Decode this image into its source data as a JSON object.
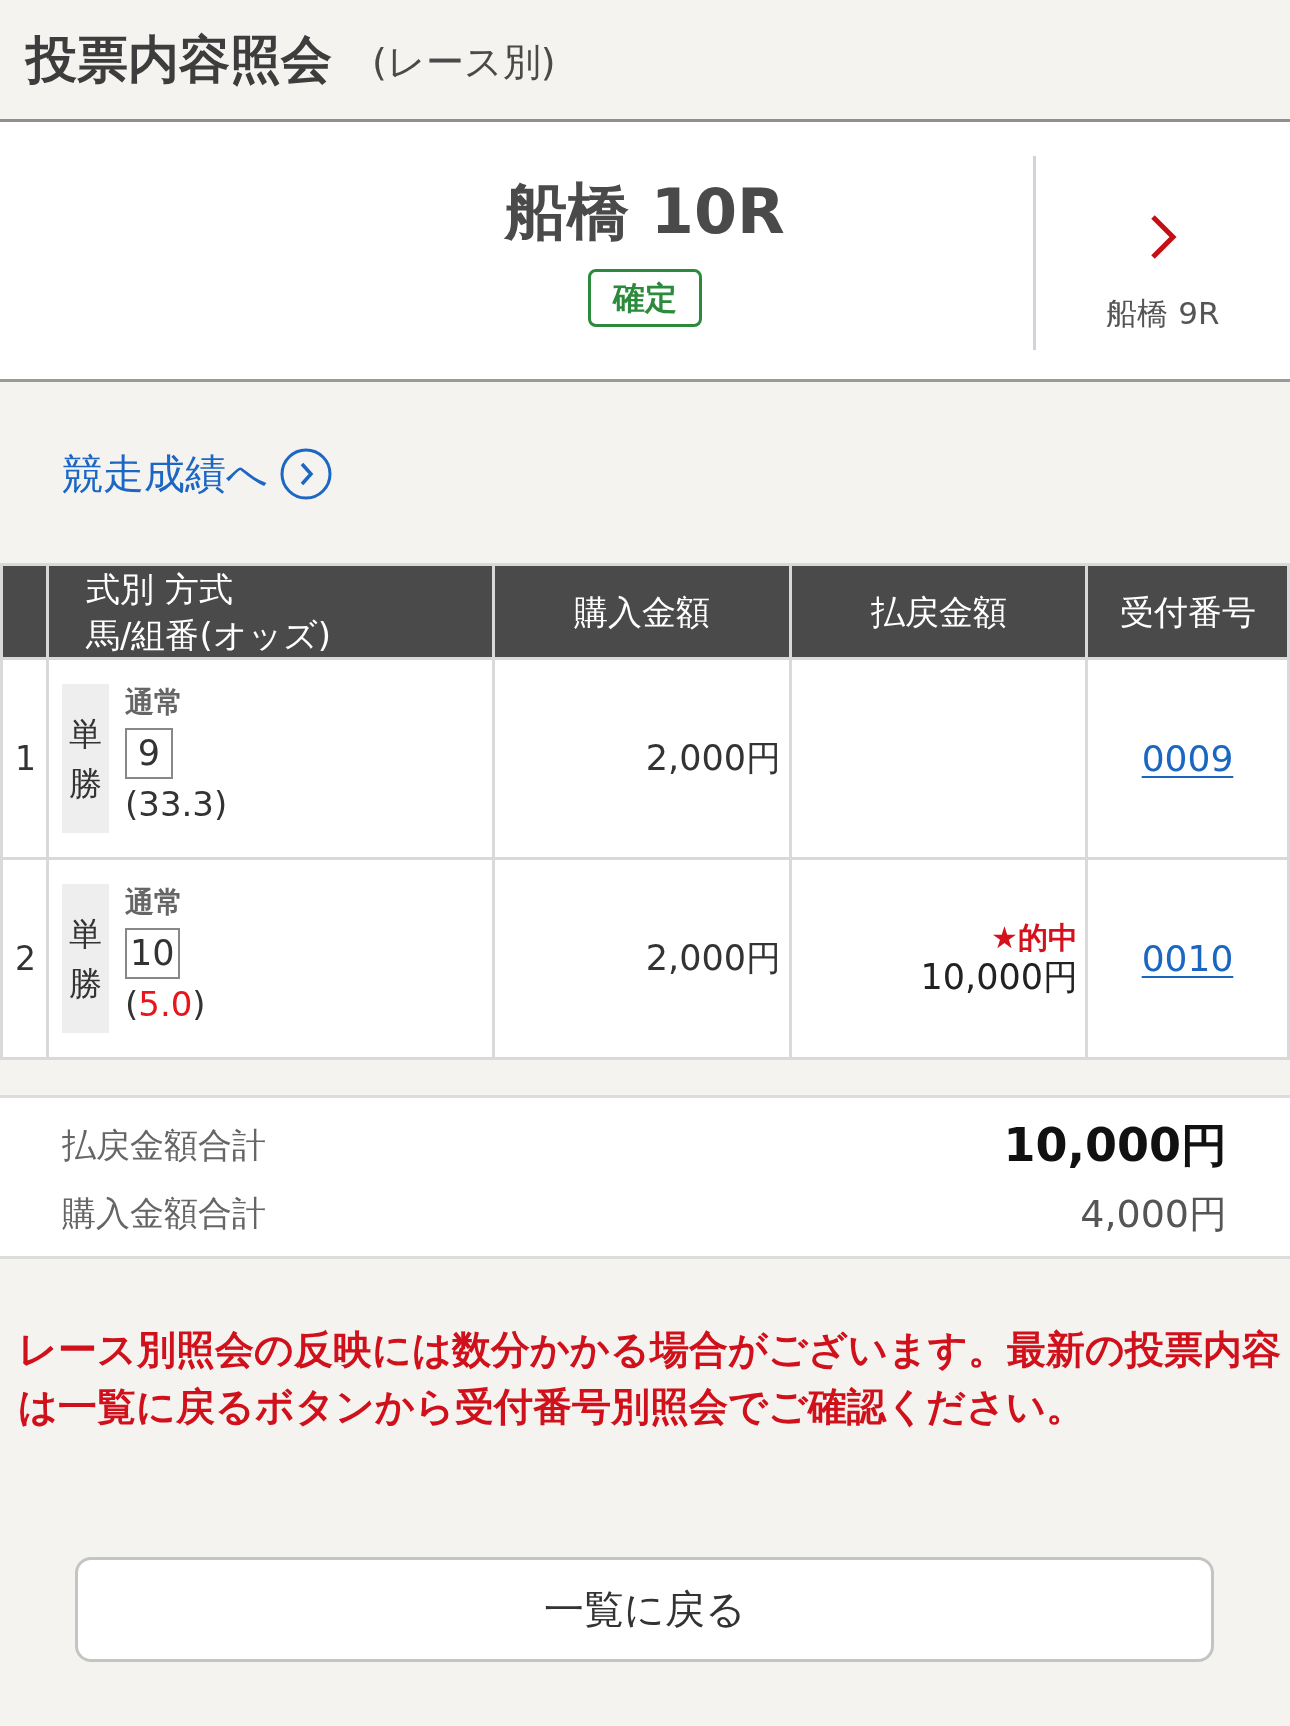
{
  "header": {
    "title": "投票内容照会",
    "subtitle": "(レース別)"
  },
  "race": {
    "name": "船橋 10R",
    "status": "確定",
    "nav_label": "船橋 9R"
  },
  "results_link": {
    "label": "競走成績へ"
  },
  "table": {
    "columns": [
      {
        "lines": [
          "式別 方式",
          "馬/組番(オッズ)"
        ]
      },
      {
        "lines": [
          "購入金額"
        ]
      },
      {
        "lines": [
          "払戻金額"
        ]
      },
      {
        "lines": [
          "受付番号"
        ]
      }
    ],
    "rows": [
      {
        "no": "1",
        "bet_type": "単勝",
        "method": "通常",
        "horse": "9",
        "odds": {
          "before": "(",
          "value": "33.3",
          "after": ")"
        },
        "hit": false,
        "amount": "2,000円",
        "receipt": "0009"
      },
      {
        "no": "2",
        "bet_type": "単勝",
        "method": "通常",
        "horse": "10",
        "odds": {
          "before": "(",
          "value": "5.0",
          "after": ")"
        },
        "hit": true,
        "amount": "2,000円",
        "hit_label": "★的中",
        "payout": "10,000円",
        "receipt": "0010"
      }
    ]
  },
  "totals": [
    {
      "label": "払戻金額合計",
      "value": "10,000円",
      "emphasis": true
    },
    {
      "label": "購入金額合計",
      "value": "4,000円",
      "emphasis": false
    }
  ],
  "notice": {
    "text": "レース別照会の反映には数分かかる場合がございます。最新の投票内容は一覧に戻るボタンから受付番号別照会でご確認ください。"
  },
  "back_button": {
    "label": "一覧に戻る"
  }
}
